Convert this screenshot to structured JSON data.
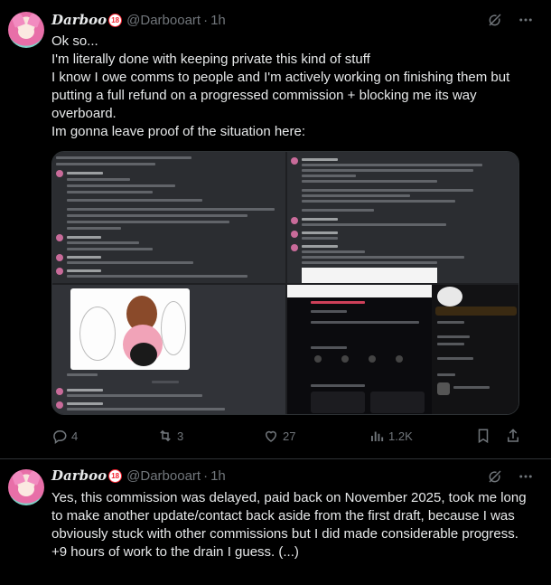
{
  "tweets": [
    {
      "author": {
        "display_name": "Darboo",
        "age_badge": "18",
        "handle": "@Darbooart",
        "time": "1h"
      },
      "text_lines": [
        "Ok so...",
        "I'm literally done with keeping private this kind of stuff",
        "I know I owe comms to people and I'm actively working on finishing them but putting a full refund on a progressed commission + blocking me its way overboard.",
        "Im gonna leave proof of the situation here:"
      ],
      "stats": {
        "replies": "4",
        "reposts": "3",
        "likes": "27",
        "views": "1.2K"
      }
    },
    {
      "author": {
        "display_name": "Darboo",
        "age_badge": "18",
        "handle": "@Darbooart",
        "time": "1h"
      },
      "text_lines": [
        "Yes, this commission was delayed, paid back on November 2025, took me long to make another update/contact back aside from the first draft, because I was obviously stuck with other commissions but I did made considerable progress.",
        "+9 hours of work to the drain I guess. (...)"
      ]
    }
  ],
  "icons": {
    "grok": "grok-icon",
    "more": "more-icon",
    "reply": "reply-icon",
    "repost": "repost-icon",
    "like": "like-icon",
    "views": "views-icon",
    "bookmark": "bookmark-icon",
    "share": "share-icon"
  },
  "colors": {
    "background": "#000000",
    "text": "#e7e9ea",
    "muted": "#71767b",
    "divider": "#2f3336"
  }
}
